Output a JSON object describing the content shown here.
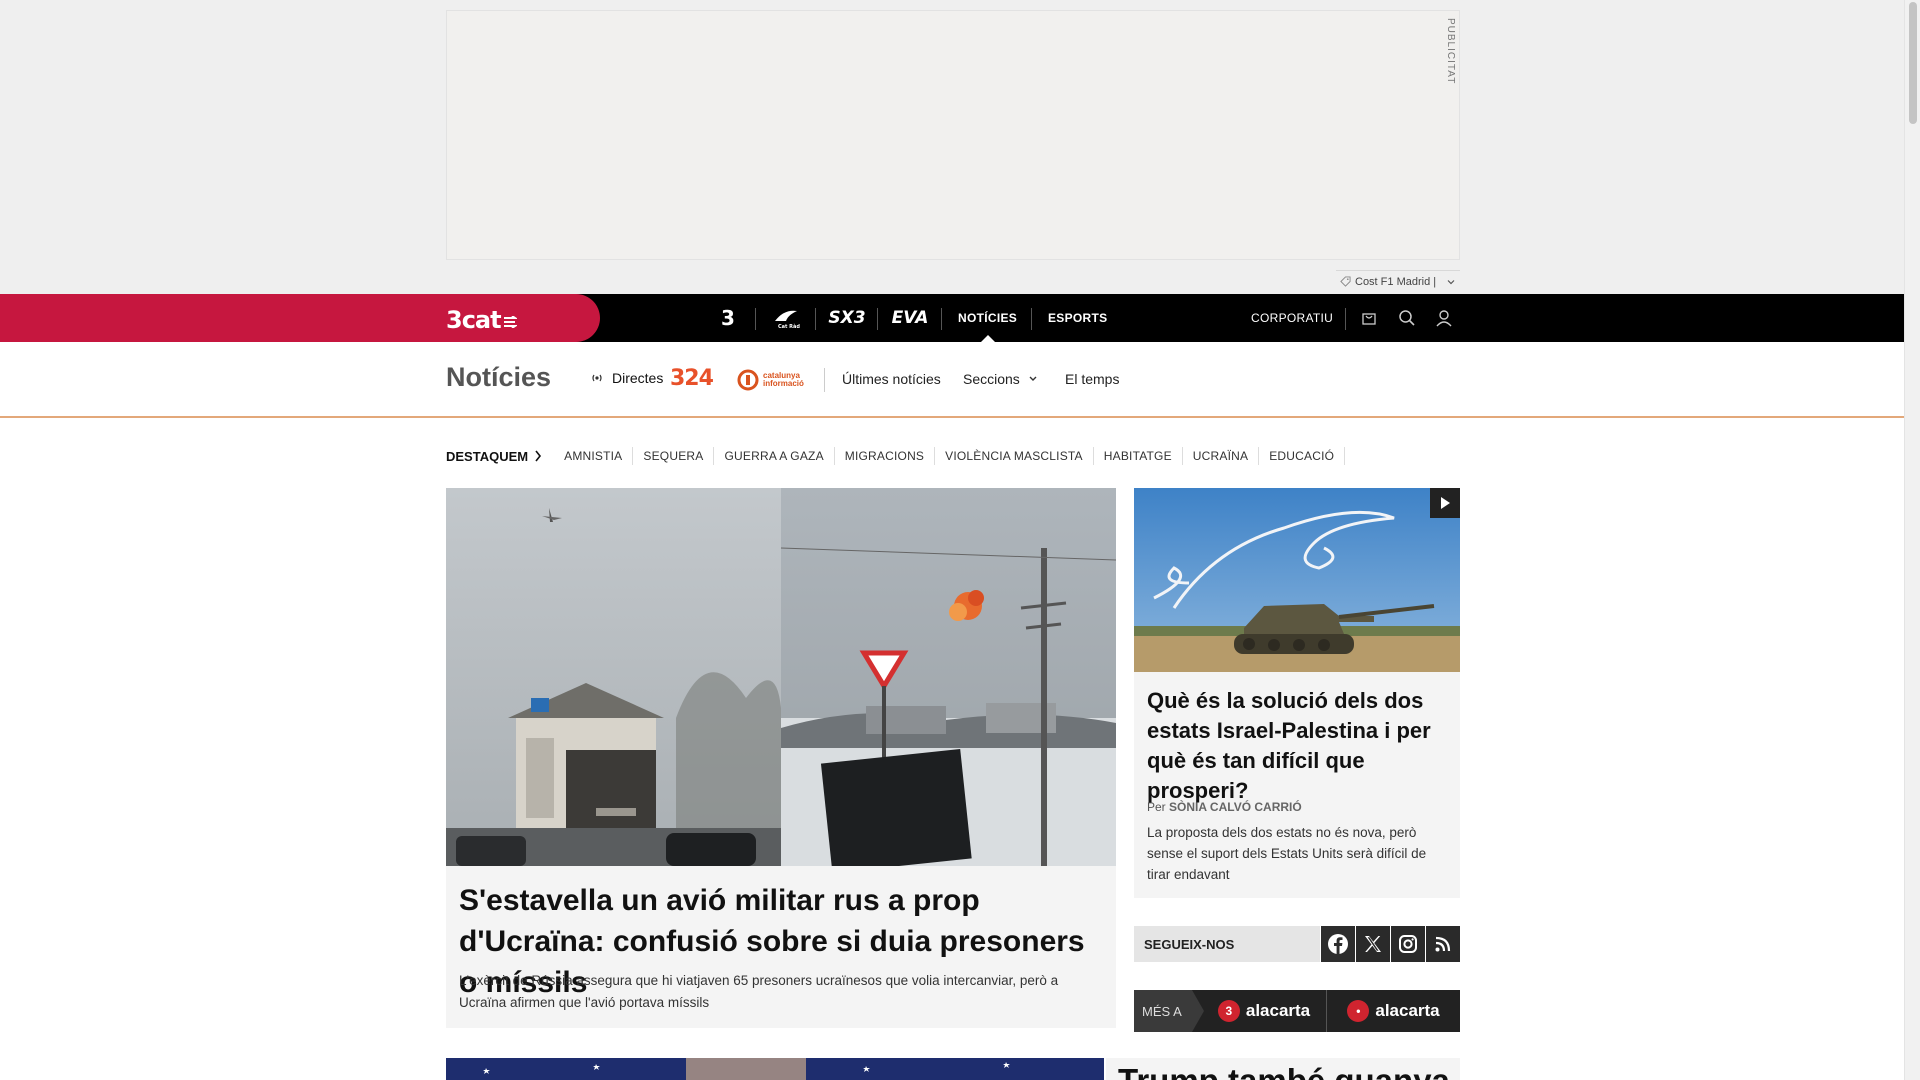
{
  "ad": {
    "label": "PUBLICITAT",
    "sponsor_text": "Cost F1 Madrid |"
  },
  "topnav": {
    "brand": "3cat",
    "channels": [
      "3",
      "Cat Ràdio",
      "SX3",
      "EVA"
    ],
    "links": [
      "NOTÍCIES",
      "ESPORTS"
    ],
    "active_link": "NOTÍCIES",
    "corporate": "CORPORATIU",
    "icons": [
      "shop-icon",
      "search-icon",
      "user-icon"
    ]
  },
  "sectionbar": {
    "title": "Notícies",
    "directes": "Directes",
    "logo_324": "324",
    "logo_ci_line1": "catalunya",
    "logo_ci_line2": "informació",
    "links": [
      "Últimes notícies",
      "Seccions",
      "El temps"
    ]
  },
  "tags": {
    "head": "DESTAQUEM",
    "items": [
      "AMNISTIA",
      "SEQUERA",
      "GUERRA A GAZA",
      "MIGRACIONS",
      "VIOLÈNCIA MASCLISTA",
      "HABITATGE",
      "UCRAÏNA",
      "EDUCACIÓ"
    ]
  },
  "main_story": {
    "title": "S'estavella un avió militar rus a prop d'Ucraïna: confusió sobre si duia presoners o míssils",
    "lead": "L'exèrcit de Rússia assegura que hi viatjaven 65 presoners ucraïnesos que volia intercanviar, però a Ucraïna afirmen que l'avió portava míssils"
  },
  "side_story": {
    "title": "Què és la solució dels dos estats Israel-Palestina i per què és tan difícil que prosperi?",
    "author_prefix": "Per",
    "author": "SÒNIA CALVÓ CARRIÓ",
    "lead": "La proposta dels dos estats no és nova, però sense el suport dels Estats Units serà difícil de tirar endavant"
  },
  "follow": {
    "label": "SEGUEIX-NOS",
    "networks": [
      "facebook-icon",
      "x-icon",
      "instagram-icon",
      "rss-icon"
    ]
  },
  "more": {
    "label": "MÉS A",
    "items": [
      {
        "badge": "3",
        "text": "alacarta"
      },
      {
        "badge": "•",
        "text": "alacarta"
      }
    ]
  },
  "bottom_story": {
    "title": "Trump també guanya"
  },
  "colors": {
    "brand_red": "#c6173f",
    "nav_black": "#000000",
    "accent_orange": "#e8512a"
  }
}
